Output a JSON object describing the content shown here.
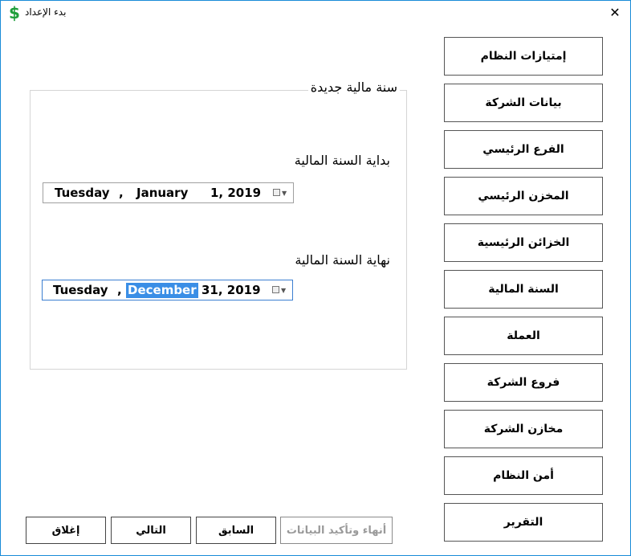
{
  "window": {
    "title": "بدء الإعداد",
    "close_symbol": "✕",
    "icon_glyph": "$"
  },
  "sidebar": {
    "items": [
      {
        "label": "إمتيازات النظام"
      },
      {
        "label": "بيانات الشركة"
      },
      {
        "label": "الفرع الرئيسي"
      },
      {
        "label": "المخزن الرئيسي"
      },
      {
        "label": "الخزائن الرئيسية"
      },
      {
        "label": "السنة المالية"
      },
      {
        "label": "العملة"
      },
      {
        "label": "فروع الشركة"
      },
      {
        "label": "مخازن الشركة"
      },
      {
        "label": "أمن النظام"
      },
      {
        "label": "التقرير"
      }
    ]
  },
  "fiscal_group": {
    "title": "سنة مالية جديدة",
    "start_label": "بداية السنة المالية",
    "start_date": {
      "weekday": "Tuesday",
      "sep": ",",
      "month": "January",
      "day_year": "1, 2019"
    },
    "end_label": "نهاية السنة المالية",
    "end_date": {
      "weekday": "Tuesday",
      "sep": ",",
      "month": "December",
      "day_year": "31, 2019"
    }
  },
  "footer": {
    "close": "إغلاق",
    "next": "التالي",
    "previous": "السابق",
    "finish": "أنهاء وتأكيد البيانات"
  },
  "colors": {
    "accent": "#1a8cd8",
    "selection": "#3a8ee6",
    "icon_green": "#1e9e3a",
    "disabled_text": "#9a9a9a"
  },
  "icons": {
    "app": "dollar-icon",
    "close": "close-icon",
    "date_dropdown": "calendar-dropdown-icon"
  }
}
